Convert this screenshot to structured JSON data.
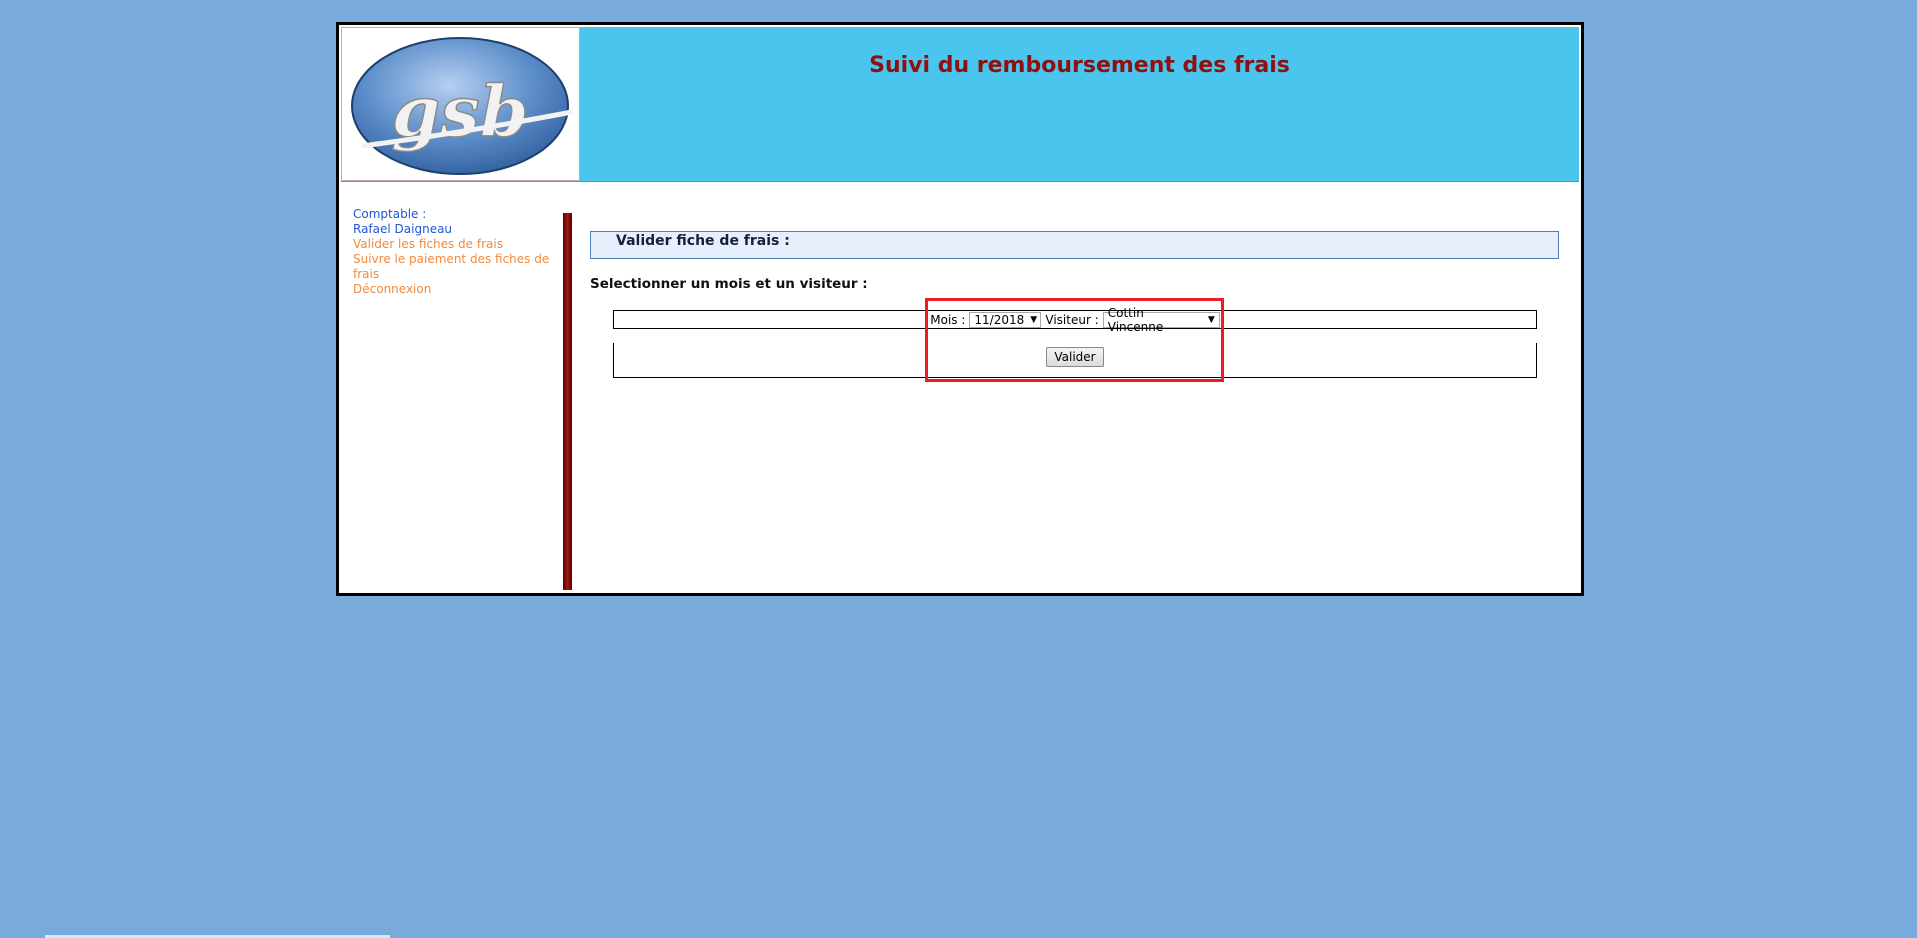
{
  "header": {
    "title": "Suivi du remboursement des frais",
    "logo_text": "gsb"
  },
  "sidebar": {
    "role_label": "Comptable :",
    "user_name": "Rafael Daigneau",
    "links": [
      {
        "label": "Valider les fiches de frais"
      },
      {
        "label": "Suivre le paiement des fiches de frais"
      },
      {
        "label": "Déconnexion"
      }
    ]
  },
  "main": {
    "section_title": "Valider fiche de frais :",
    "prompt": "Selectionner un mois et un visiteur :",
    "month_label": "Mois :",
    "month_value": "11/2018",
    "visitor_label": "Visiteur :",
    "visitor_value": "Cottin Vincenne",
    "submit_label": "Valider"
  },
  "colors": {
    "background": "#78aadc",
    "header": "#4ac6ee",
    "title": "#8e1010",
    "link": "#f18a3c",
    "user": "#2156d6",
    "highlight": "#ee1b24"
  }
}
